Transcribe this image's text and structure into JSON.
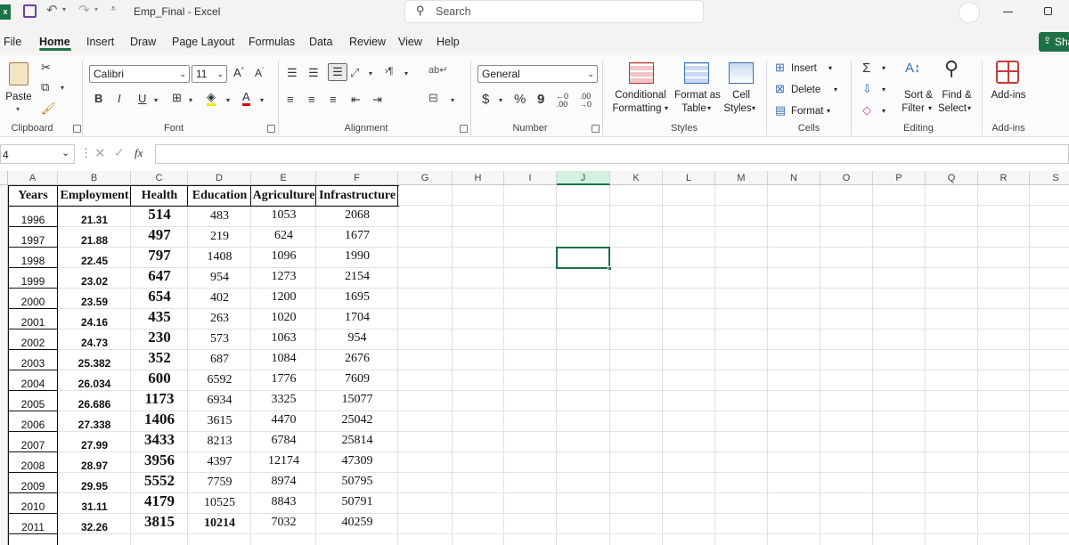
{
  "titlebar": {
    "app_icon": "excel-logo",
    "title": "Emp_Final  -  Excel",
    "search_placeholder": "Search"
  },
  "menu": {
    "tabs": [
      "File",
      "Home",
      "Insert",
      "Draw",
      "Page Layout",
      "Formulas",
      "Data",
      "Review",
      "View",
      "Help"
    ],
    "active": "Home",
    "share_label": "Sha"
  },
  "ribbon": {
    "clipboard": {
      "paste": "Paste",
      "label": "Clipboard"
    },
    "font": {
      "name": "Calibri",
      "size": "11",
      "bold": "B",
      "italic": "I",
      "underline": "U",
      "label": "Font"
    },
    "alignment": {
      "label": "Alignment"
    },
    "number": {
      "format": "General",
      "currency": "$",
      "percent": "%",
      "comma": "9",
      "label": "Number"
    },
    "styles": {
      "conditional": "Conditional",
      "conditional2": "Formatting",
      "format_as": "Format as",
      "format_as2": "Table",
      "cell_styles": "Cell",
      "cell_styles2": "Styles",
      "label": "Styles"
    },
    "cells": {
      "insert": "Insert",
      "delete": "Delete",
      "format": "Format",
      "label": "Cells"
    },
    "editing": {
      "sort": "Sort &",
      "sort2": "Filter",
      "find": "Find &",
      "find2": "Select",
      "label": "Editing"
    },
    "addins": {
      "addins": "Add-ins",
      "label": "Add-ins"
    }
  },
  "formula_bar": {
    "name_box": "4",
    "fx": "fx",
    "value": ""
  },
  "sheet": {
    "columns": [
      "A",
      "B",
      "C",
      "D",
      "E",
      "F",
      "G",
      "H",
      "I",
      "J",
      "K",
      "L",
      "M",
      "N",
      "O",
      "P",
      "Q",
      "R",
      "S"
    ],
    "selected_column": "J",
    "headers": [
      "Years",
      "Employment",
      "Health",
      "Education",
      "Agriculture",
      "Infrastructure"
    ],
    "rows": [
      [
        "1996",
        "21.31",
        "514",
        "483",
        "1053",
        "2068"
      ],
      [
        "1997",
        "21.88",
        "497",
        "219",
        "624",
        "1677"
      ],
      [
        "1998",
        "22.45",
        "797",
        "1408",
        "1096",
        "1990"
      ],
      [
        "1999",
        "23.02",
        "647",
        "954",
        "1273",
        "2154"
      ],
      [
        "2000",
        "23.59",
        "654",
        "402",
        "1200",
        "1695"
      ],
      [
        "2001",
        "24.16",
        "435",
        "263",
        "1020",
        "1704"
      ],
      [
        "2002",
        "24.73",
        "230",
        "573",
        "1063",
        "954"
      ],
      [
        "2003",
        "25.382",
        "352",
        "687",
        "1084",
        "2676"
      ],
      [
        "2004",
        "26.034",
        "600",
        "6592",
        "1776",
        "7609"
      ],
      [
        "2005",
        "26.686",
        "1173",
        "6934",
        "3325",
        "15077"
      ],
      [
        "2006",
        "27.338",
        "1406",
        "3615",
        "4470",
        "25042"
      ],
      [
        "2007",
        "27.99",
        "3433",
        "8213",
        "6784",
        "25814"
      ],
      [
        "2008",
        "28.97",
        "3956",
        "4397",
        "12174",
        "47309"
      ],
      [
        "2009",
        "29.95",
        "5552",
        "7759",
        "8974",
        "50795"
      ],
      [
        "2010",
        "31.11",
        "4179",
        "10525",
        "8843",
        "50791"
      ],
      [
        "2011",
        "32.26",
        "3815",
        "10214",
        "7032",
        "40259"
      ]
    ]
  }
}
